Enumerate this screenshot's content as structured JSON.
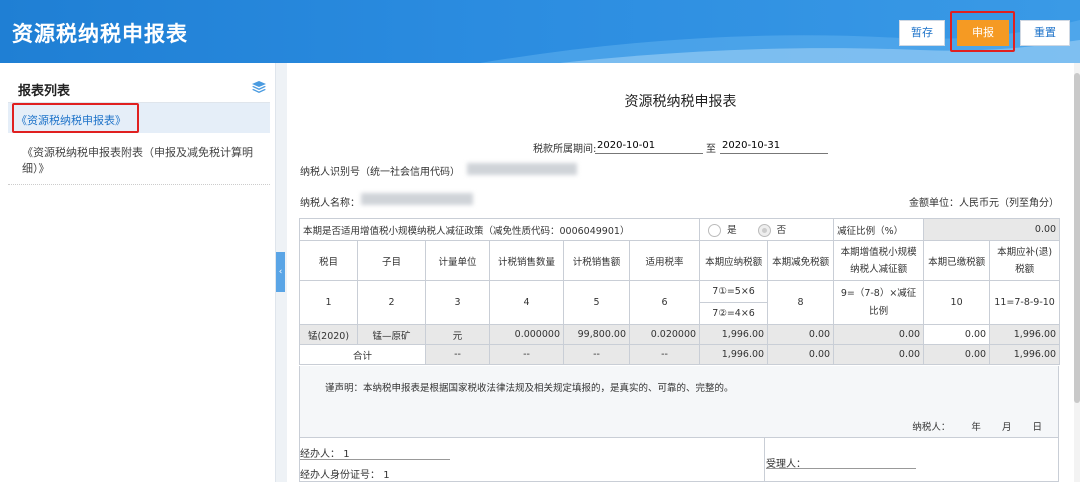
{
  "header": {
    "title": "资源税纳税申报表",
    "buttons": {
      "save": "暂存",
      "submit": "申报",
      "reset": "重置"
    }
  },
  "sidebar": {
    "title": "报表列表",
    "items": [
      {
        "label": "《资源税纳税申报表》",
        "active": true
      },
      {
        "label": "《资源税纳税申报表附表（申报及减免税计算明细）》",
        "active": false
      }
    ]
  },
  "form": {
    "title": "资源税纳税申报表",
    "period_label": "税款所属期间:",
    "period_from": "2020-10-01",
    "period_to_label": "至",
    "period_to": "2020-10-31",
    "taxpayer_id_label": "纳税人识别号（统一社会信用代码）",
    "taxpayer_name_label": "纳税人名称：",
    "amount_unit": "金额单位：人民币元（列至角分）",
    "policy_question": "本期是否适用增值税小规模纳税人减征政策（减免性质代码：0006049901）",
    "option_yes": "是",
    "option_no": "否",
    "reduction_ratio_label": "减征比例（%）",
    "reduction_ratio_value": "0.00",
    "columns": [
      "税目",
      "子目",
      "计量单位",
      "计税销售数量",
      "计税销售额",
      "适用税率",
      "本期应纳税额",
      "本期减免税额",
      "本期增值税小规模纳税人减征额",
      "本期已缴税额",
      "本期应补(退)税额"
    ],
    "column_numbers": [
      "1",
      "2",
      "3",
      "4",
      "5",
      "6",
      "7①=5×6",
      "7②=4×6",
      "8",
      "9=（7-8）×减征比例",
      "10",
      "11=7-8-9-10"
    ],
    "rows": [
      {
        "item": "锰(2020)",
        "sub": "锰—原矿",
        "unit": "元",
        "qty": "0.000000",
        "sales": "99,800.00",
        "rate": "0.020000",
        "payable": "1,996.00",
        "exempt": "0.00",
        "reduction": "0.00",
        "paid": "0.00",
        "due": "1,996.00"
      }
    ],
    "total": {
      "label": "合计",
      "unit": "--",
      "qty": "--",
      "sales": "--",
      "rate": "--",
      "payable": "1,996.00",
      "exempt": "0.00",
      "reduction": "0.00",
      "paid": "0.00",
      "due": "1,996.00"
    },
    "declaration": "谨声明：本纳税申报表是根据国家税收法律法规及相关规定填报的，是真实的、可靠的、完整的。",
    "signer_label": "纳税人：",
    "year": "年",
    "month": "月",
    "day": "日",
    "agent_label": "经办人：",
    "agent_value": "1",
    "agent_id_label": "经办人身份证号：",
    "agent_id_value": "1",
    "receiver_label": "受理人："
  },
  "colors": {
    "header": "#2b8ce0",
    "submit": "#f59a23",
    "highlight": "#e02020",
    "link": "#1e73c9"
  },
  "icons": {
    "layers": "layers-icon",
    "collapse": "chevron-left-icon"
  }
}
